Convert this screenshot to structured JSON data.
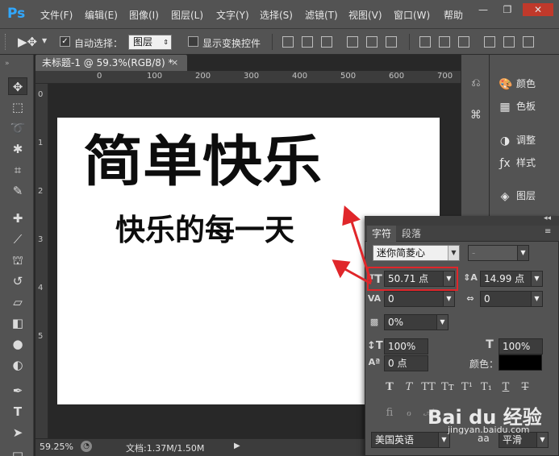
{
  "app": {
    "logo": "Ps"
  },
  "menu": [
    "文件(F)",
    "编辑(E)",
    "图像(I)",
    "图层(L)",
    "文字(Y)",
    "选择(S)",
    "滤镜(T)",
    "视图(V)",
    "窗口(W)",
    "帮助"
  ],
  "window_controls": {
    "minimize": "—",
    "restore": "❐",
    "close": "✕"
  },
  "options": {
    "auto_select_label": "自动选择：",
    "auto_select_checked": true,
    "auto_select_value": "图层",
    "show_transform_label": "显示变换控件",
    "show_transform_checked": false
  },
  "document": {
    "tab_title": "未标题-1 @ 59.3%(RGB/8) *",
    "close": "×",
    "ruler_top": [
      "0",
      "100",
      "200",
      "300",
      "400",
      "500",
      "600",
      "700"
    ],
    "ruler_left": [
      "0",
      "1",
      "2",
      "3",
      "4",
      "5"
    ],
    "title_text": "简单快乐",
    "subtitle_text": "快乐的每一天"
  },
  "status": {
    "zoom": "59.25%",
    "doc_size": "文档:1.37M/1.50M"
  },
  "dock": [
    {
      "label": "颜色",
      "icon": "palette-icon"
    },
    {
      "label": "色板",
      "icon": "swatches-icon"
    },
    {
      "label": "调整",
      "icon": "adjustments-icon"
    },
    {
      "label": "样式",
      "icon": "styles-icon"
    },
    {
      "label": "图层",
      "icon": "layers-icon"
    }
  ],
  "char_panel": {
    "tabs": [
      "字符",
      "段落"
    ],
    "font_family": "迷你简菱心",
    "font_style": "-",
    "font_size": "50.71 点",
    "leading": "14.99 点",
    "kerning": "0",
    "tracking": "0",
    "tsume": "0%",
    "vertical_scale": "100%",
    "horizontal_scale": "100%",
    "baseline_shift": "0 点",
    "color_label": "颜色：",
    "color": "#000000",
    "language": "美国英语",
    "antialias": "平滑"
  },
  "watermark": {
    "brand": "Bai du 经验",
    "url": "jingyan.baidu.com"
  },
  "colors": {
    "menu_bg": "#535353",
    "panel_bg": "#535353",
    "canvas_bg": "#282828",
    "highlight": "#e0262a",
    "ps_blue": "#31a8ff"
  }
}
